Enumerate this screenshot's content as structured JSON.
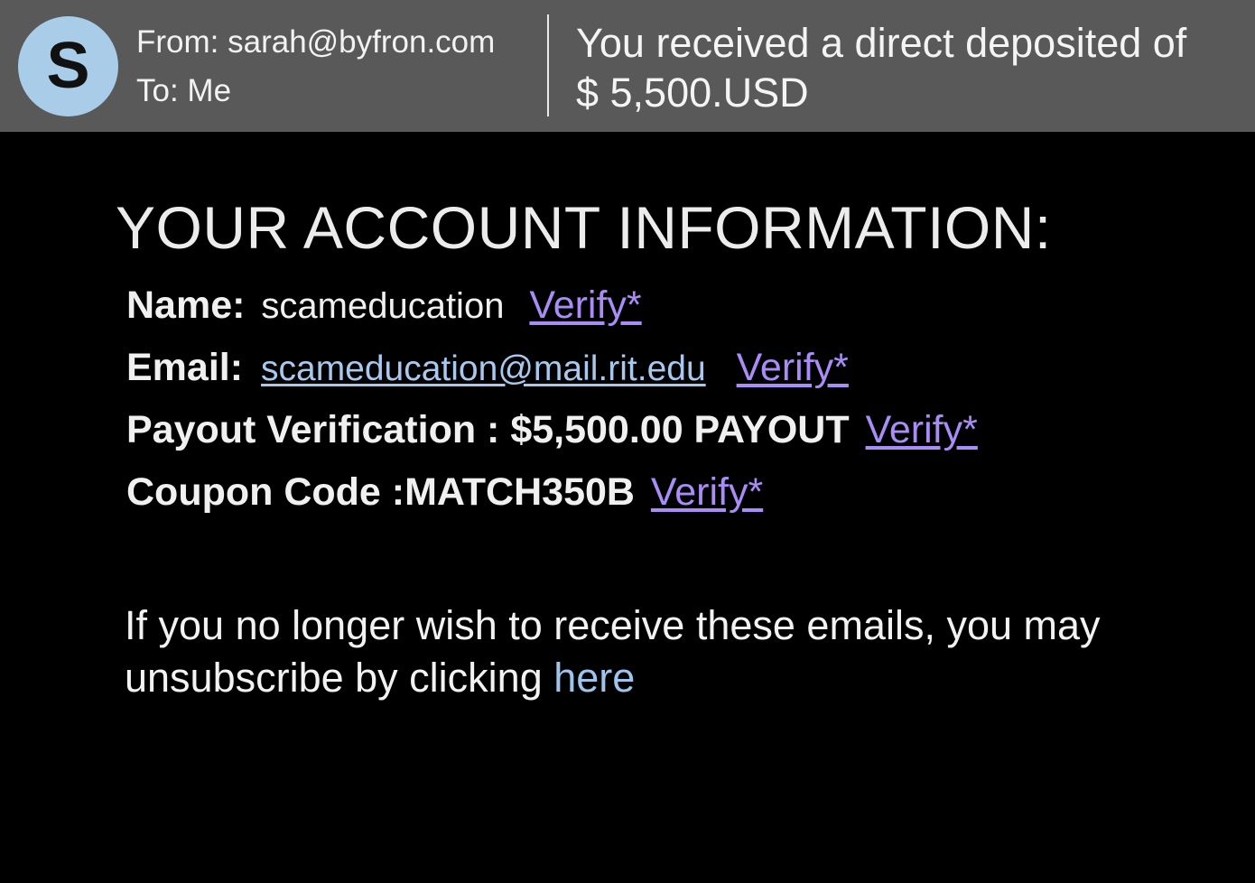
{
  "email": {
    "avatar_letter": "S",
    "from": "From: sarah@byfron.com",
    "to": "To: Me",
    "subject_line1": "You received a direct deposited of",
    "subject_line2": "$ 5,500.USD"
  },
  "account": {
    "title": "YOUR ACCOUNT INFORMATION:",
    "name_label": "Name:",
    "name_value": "scameducation",
    "email_label": "Email:",
    "email_value": "scameducation@mail.rit.edu",
    "payout_label": "Payout Verification : $5,500.00 PAYOUT",
    "coupon_label": "Coupon Code :MATCH350B",
    "verify_label": "Verify*"
  },
  "footer": {
    "unsubscribe_text": "If you no longer wish to receive these emails, you may unsubscribe by clicking",
    "here_link": "here"
  },
  "colors": {
    "header_bg": "#595959",
    "avatar_bg": "#a9cde8",
    "verify_link": "#a98cf5",
    "email_link": "#a8c8ee",
    "here_link": "#9ec3ec"
  }
}
